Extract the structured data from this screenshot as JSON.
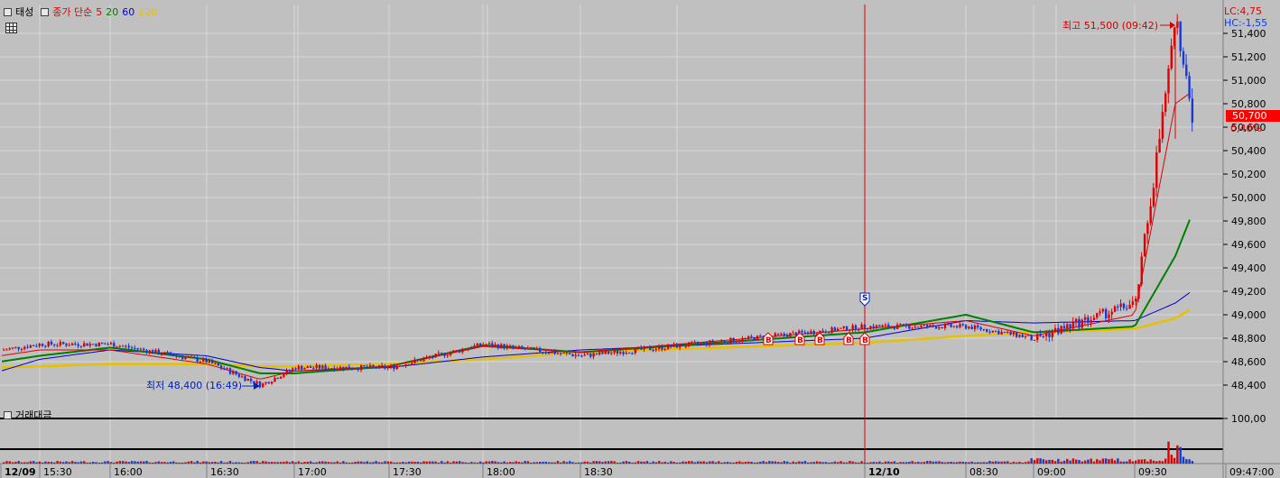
{
  "legend": {
    "price_name": "태성",
    "ma_label": "종가 단순",
    "ma_periods": [
      "5",
      "20",
      "60",
      "120"
    ],
    "ma_colors": [
      "#e00000",
      "#008000",
      "#0000d0",
      "#e8c000"
    ],
    "volume_name": "거래대금"
  },
  "colors": {
    "background": "#c0c0c0",
    "up": "#e00000",
    "down": "#1838d8",
    "cursor_line": "#e00000",
    "current_price_box": "#ff0000"
  },
  "header_right": {
    "lc": "LC:4,75",
    "hc": "HC:-1,55"
  },
  "current_price": {
    "value": "50,700",
    "change": "0,40%"
  },
  "annotations": {
    "high": "최고 51,500 (09:42)",
    "low": "최저 48,400 (16:49)"
  },
  "y_axis": [
    "51,400",
    "51,200",
    "51,000",
    "50,800",
    "50,600",
    "50,400",
    "50,200",
    "50,000",
    "49,800",
    "49,600",
    "49,400",
    "49,200",
    "49,000",
    "48,800",
    "48,600",
    "48,400"
  ],
  "volume_axis_label": "100,00",
  "x_axis": [
    "12/09",
    "15:30",
    "16:00",
    "16:30",
    "17:00",
    "17:30",
    "18:00",
    "18:30",
    "12/10",
    "08:30",
    "09:00",
    "09:30",
    "09:47:00"
  ],
  "signals": {
    "sell": "S",
    "buy": "B",
    "buy_count": 5
  },
  "chart_data": {
    "type": "line",
    "title": "태성",
    "x": [
      "12/09",
      "15:30",
      "16:00",
      "16:30",
      "16:49",
      "17:00",
      "17:30",
      "18:00",
      "18:30",
      "12/10",
      "08:30",
      "09:00",
      "09:30",
      "09:42",
      "09:47"
    ],
    "series": [
      {
        "name": "종가",
        "values": [
          48700,
          48750,
          48750,
          48600,
          48400,
          48550,
          48550,
          48750,
          48650,
          48900,
          48900,
          48800,
          49100,
          51500,
          50700
        ]
      },
      {
        "name": "5",
        "values": [
          48650,
          48700,
          48700,
          48580,
          48450,
          48520,
          48560,
          48730,
          48680,
          48880,
          48950,
          48820,
          49000,
          50800,
          50900
        ]
      },
      {
        "name": "20",
        "values": [
          48600,
          48650,
          48720,
          48620,
          48500,
          48500,
          48560,
          48740,
          48680,
          48850,
          49000,
          48850,
          48900,
          49500,
          49850
        ]
      },
      {
        "name": "60",
        "values": [
          48520,
          48620,
          48700,
          48650,
          48550,
          48520,
          48550,
          48640,
          48700,
          48800,
          48950,
          48930,
          48950,
          49100,
          49200
        ]
      },
      {
        "name": "120",
        "values": [
          48550,
          48560,
          48580,
          48580,
          48560,
          48560,
          48580,
          48620,
          48680,
          48760,
          48820,
          48850,
          48880,
          48970,
          49050
        ]
      }
    ],
    "ylim": [
      48300,
      51600
    ],
    "high": 51500,
    "low": 48400,
    "current": 50700
  }
}
